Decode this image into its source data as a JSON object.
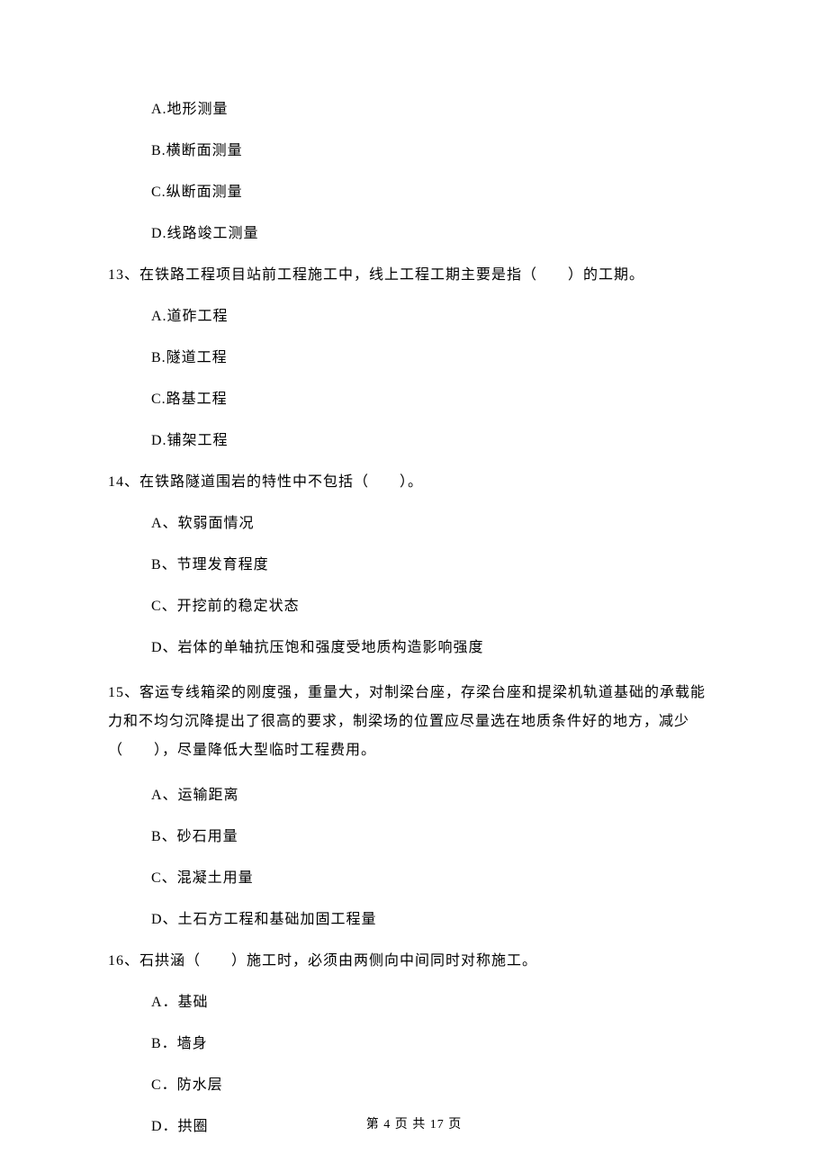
{
  "q12": {
    "options": {
      "a": "A.地形测量",
      "b": "B.横断面测量",
      "c": "C.纵断面测量",
      "d": "D.线路竣工测量"
    }
  },
  "q13": {
    "text": "13、在铁路工程项目站前工程施工中，线上工程工期主要是指（　　）的工期。",
    "options": {
      "a": "A.道砟工程",
      "b": "B.隧道工程",
      "c": "C.路基工程",
      "d": "D.铺架工程"
    }
  },
  "q14": {
    "text": "14、在铁路隧道围岩的特性中不包括（　　）。",
    "options": {
      "a": "A、软弱面情况",
      "b": "B、节理发育程度",
      "c": "C、开挖前的稳定状态",
      "d": "D、岩体的单轴抗压饱和强度受地质构造影响强度"
    }
  },
  "q15": {
    "text": "15、客运专线箱梁的刚度强，重量大，对制梁台座，存梁台座和提梁机轨道基础的承载能力和不均匀沉降提出了很高的要求，制梁场的位置应尽量选在地质条件好的地方，减少（　　），尽量降低大型临时工程费用。",
    "options": {
      "a": "A、运输距离",
      "b": "B、砂石用量",
      "c": "C、混凝土用量",
      "d": "D、土石方工程和基础加固工程量"
    }
  },
  "q16": {
    "text": "16、石拱涵（　　）施工时，必须由两侧向中间同时对称施工。",
    "options": {
      "a": "A．基础",
      "b": "B．墙身",
      "c": "C．防水层",
      "d": "D．拱圈"
    }
  },
  "footer": "第 4 页 共 17 页"
}
